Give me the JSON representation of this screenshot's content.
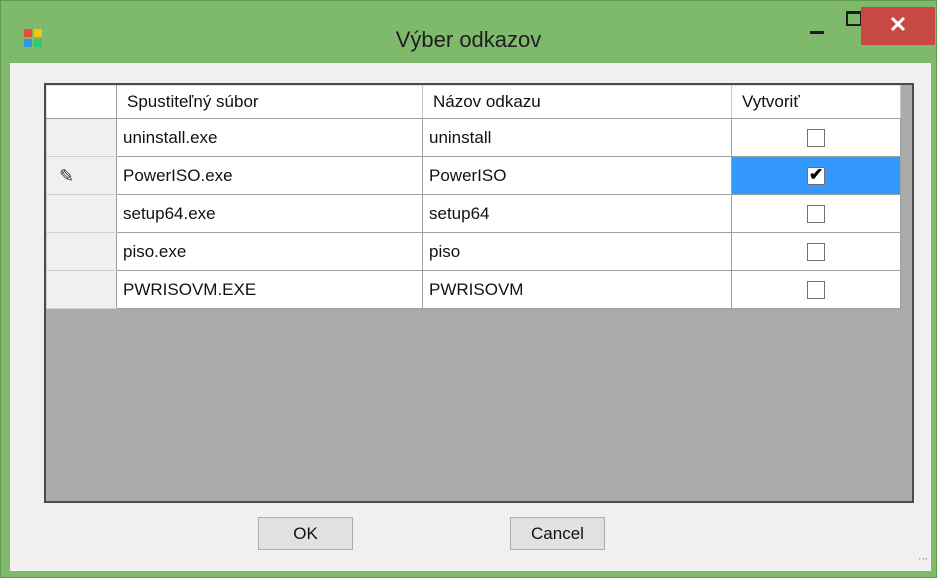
{
  "window": {
    "title": "Výber odkazov",
    "accent_color": "#7fba6c",
    "close_color": "#c74845",
    "close_label": "✕"
  },
  "grid": {
    "columns": [
      "Spustiteľný súbor",
      "Názov odkazu",
      "Vytvoriť"
    ],
    "rows": [
      {
        "file": "uninstall.exe",
        "name": "uninstall",
        "create": false,
        "editing": false
      },
      {
        "file": "PowerISO.exe",
        "name": "PowerISO",
        "create": true,
        "editing": true
      },
      {
        "file": "setup64.exe",
        "name": "setup64",
        "create": false,
        "editing": false
      },
      {
        "file": "piso.exe",
        "name": "piso",
        "create": false,
        "editing": false
      },
      {
        "file": "PWRISOVM.EXE",
        "name": "PWRISOVM",
        "create": false,
        "editing": false
      }
    ],
    "selection_color": "#3399ff",
    "edit_icon": "pencil-icon"
  },
  "buttons": {
    "ok": "OK",
    "cancel": "Cancel"
  }
}
